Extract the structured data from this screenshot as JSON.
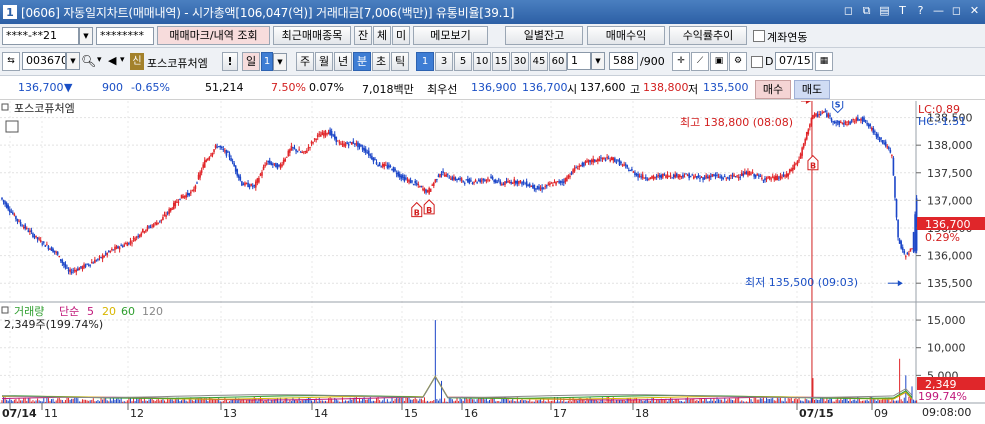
{
  "window": {
    "number": "1",
    "title": "[0606] 자동일지차트(매매내역) - 시가총액[106,047(억)] 거래대금[7,006(백만)] 유통비율[39.1]",
    "controls": [
      "◻",
      "⧉",
      "▤",
      "T",
      "?",
      "—",
      "◻",
      "✕"
    ]
  },
  "toolbar1": {
    "account": "****-**21",
    "password": "********",
    "btn_mark": "매매마크/내역 조회",
    "btn_recent": "최근매매종목",
    "btn_jan": "잔",
    "btn_che": "체",
    "btn_mi": "미",
    "btn_memo": "메모보기",
    "btn_daily": "일별잔고",
    "btn_profit": "매매수익",
    "btn_rate": "수익률추이",
    "link_label": "계좌연동"
  },
  "toolbar2": {
    "code": "003670",
    "stock_badge": "신",
    "stock_name": "포스코퓨처엠",
    "warn": "!",
    "period": "일",
    "period_count": "1",
    "periods": [
      "주",
      "월",
      "년",
      "분",
      "초",
      "틱"
    ],
    "active_period": "분",
    "intervals": [
      "1",
      "3",
      "5",
      "10",
      "15",
      "30",
      "45",
      "60"
    ],
    "active_interval": "1",
    "count": "1",
    "bars": "588",
    "bars_total": "/900",
    "date_check": "D",
    "date": "07/15"
  },
  "quote": {
    "price": "136,700",
    "arrow": "▼",
    "change": "900",
    "change_pct": "-0.65%",
    "volume": "51,214",
    "turnover": "7.50%",
    "ratio": "0.07%",
    "amount": "7,018백만",
    "best_label": "최우선",
    "best_ask": "136,900",
    "best_bid": "136,700",
    "open_label": "시",
    "open": "137,600",
    "high_label": "고",
    "high": "138,800",
    "low_label": "저",
    "low": "135,500",
    "buy": "매수",
    "sell": "매도"
  },
  "panel": {
    "name": "포스코퓨처엠",
    "lc": "LC:0.89",
    "hc": "HC:-1.51",
    "max_label": "최고 138,800 (08:08)",
    "min_label": "최저 135,500 (09:03)",
    "price_box": "136,700",
    "pct_box": "0.29%",
    "vol_box": "2,349",
    "vol_pct_box": "199.74%"
  },
  "volume_panel": {
    "title": "거래량",
    "ma_label": "단순",
    "ma": [
      "5",
      "20",
      "60",
      "120"
    ],
    "ma_colors": [
      "#c0187a",
      "#d8b600",
      "#2e9e2e",
      "#888888"
    ],
    "summary": "2,349주(199.74%)"
  },
  "price_axis": [
    "138,500",
    "138,000",
    "137,500",
    "137,000",
    "136,500",
    "136,000",
    "135,500"
  ],
  "volume_axis": [
    "15,000",
    "10,000",
    "5,000"
  ],
  "x_axis": [
    {
      "label": "07/14",
      "bold": true
    },
    {
      "label": "11"
    },
    {
      "label": "12"
    },
    {
      "label": "13"
    },
    {
      "label": "14"
    },
    {
      "label": "15"
    },
    {
      "label": "16"
    },
    {
      "label": "17"
    },
    {
      "label": "18"
    },
    {
      "label": "07/15",
      "bold": true
    },
    {
      "label": "09"
    }
  ],
  "time_label": "09:08:00",
  "colors": {
    "up": "#e0262a",
    "down": "#1c46c8",
    "accent": "#3e7dd4",
    "title": "#2c5fa5"
  },
  "chart_data": {
    "type": "candlestick",
    "price_range": [
      135250,
      138800
    ],
    "volume_range": [
      0,
      17000
    ],
    "price_path": [
      [
        0,
        137050
      ],
      [
        3,
        136600
      ],
      [
        6,
        136300
      ],
      [
        9,
        136050
      ],
      [
        11,
        135700
      ],
      [
        13,
        135780
      ],
      [
        16,
        135950
      ],
      [
        18,
        136100
      ],
      [
        21,
        136250
      ],
      [
        23,
        136450
      ],
      [
        26,
        136650
      ],
      [
        29,
        137050
      ],
      [
        31,
        137150
      ],
      [
        33,
        137700
      ],
      [
        35,
        138000
      ],
      [
        37,
        137800
      ],
      [
        39,
        137300
      ],
      [
        41,
        137250
      ],
      [
        43,
        137700
      ],
      [
        45,
        137600
      ],
      [
        47,
        137950
      ],
      [
        49,
        137850
      ],
      [
        51,
        138150
      ],
      [
        53,
        138250
      ],
      [
        55,
        138000
      ],
      [
        57,
        138050
      ],
      [
        59,
        137900
      ],
      [
        61,
        137650
      ],
      [
        63,
        137600
      ],
      [
        65,
        137400
      ],
      [
        67,
        137300
      ],
      [
        69,
        137150
      ],
      [
        71,
        137500
      ],
      [
        73,
        137400
      ],
      [
        75,
        137350
      ],
      [
        77,
        137350
      ],
      [
        79,
        137400
      ],
      [
        81,
        137300
      ],
      [
        83,
        137350
      ],
      [
        85,
        137300
      ],
      [
        87,
        137200
      ],
      [
        89,
        137300
      ],
      [
        91,
        137350
      ],
      [
        93,
        137600
      ],
      [
        95,
        137700
      ],
      [
        97,
        137750
      ],
      [
        99,
        137750
      ],
      [
        101,
        137600
      ],
      [
        103,
        137450
      ],
      [
        105,
        137400
      ],
      [
        107,
        137450
      ],
      [
        109,
        137450
      ],
      [
        111,
        137450
      ],
      [
        113,
        137400
      ],
      [
        115,
        137450
      ],
      [
        117,
        137400
      ],
      [
        119,
        137450
      ],
      [
        121,
        137500
      ],
      [
        123,
        137400
      ],
      [
        125,
        137400
      ],
      [
        127,
        137450
      ],
      [
        129,
        137750
      ],
      [
        130,
        138100
      ],
      [
        131,
        138500
      ],
      [
        133,
        138600
      ],
      [
        135,
        138400
      ],
      [
        137,
        138400
      ],
      [
        139,
        138500
      ],
      [
        141,
        138250
      ],
      [
        143,
        138000
      ],
      [
        144,
        137800
      ],
      [
        145,
        136300
      ],
      [
        146,
        136000
      ],
      [
        147,
        136100
      ],
      [
        148,
        137400
      ]
    ],
    "candle_count": 148,
    "high": {
      "index": 131,
      "value": 138800,
      "time": "08:08"
    },
    "low": {
      "index": 146,
      "value": 135500,
      "time": "09:03"
    },
    "buy_marks": [
      [
        67,
        137050
      ],
      [
        69,
        137100
      ],
      [
        131,
        137900
      ]
    ],
    "sell_marks": [
      [
        135,
        138500
      ]
    ],
    "volume_spikes": [
      [
        70,
        15000
      ],
      [
        71,
        4000
      ],
      [
        131,
        4500
      ],
      [
        145,
        8000
      ],
      [
        146,
        5000
      ],
      [
        147,
        3000
      ]
    ],
    "session_break_index": 131
  }
}
